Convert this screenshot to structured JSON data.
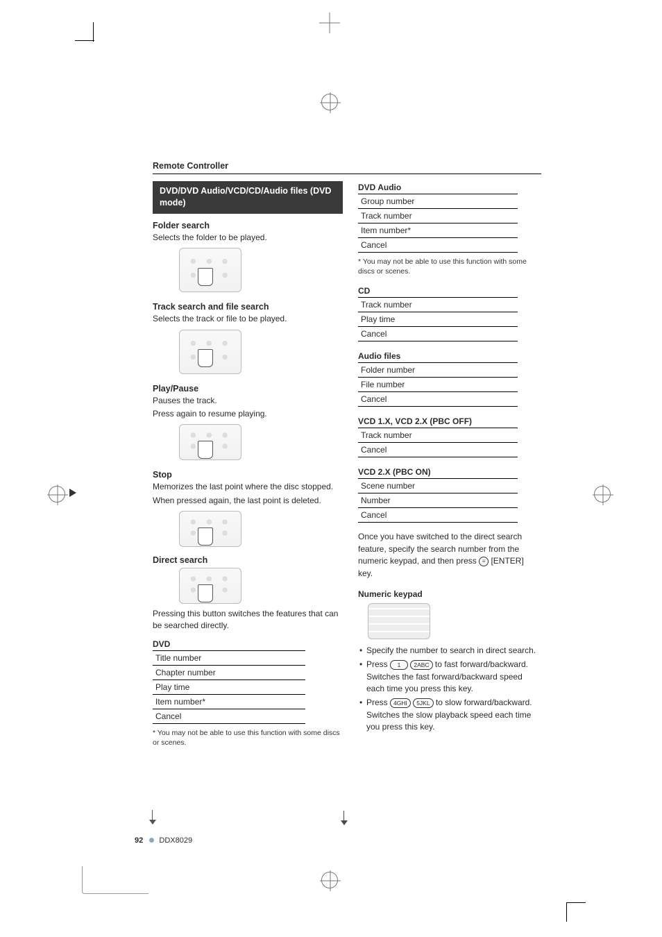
{
  "doc": {
    "header": "Remote Controller",
    "band": "DVD/DVD Audio/VCD/CD/Audio files (DVD mode)"
  },
  "left": {
    "folder_search": {
      "h": "Folder search",
      "p": "Selects the folder to be played."
    },
    "track_search": {
      "h": "Track search and file search",
      "p": "Selects the track or file to be played."
    },
    "play_pause": {
      "h": "Play/Pause",
      "p1": "Pauses the track.",
      "p2": "Press again to resume playing."
    },
    "stop": {
      "h": "Stop",
      "p1": "Memorizes the last point where the disc stopped.",
      "p2": "When pressed again, the last point is deleted."
    },
    "direct_search": {
      "h": "Direct search",
      "p": "Pressing this button switches the features that can be searched directly."
    },
    "dvd": {
      "h": "DVD",
      "rows": [
        "Title number",
        "Chapter number",
        "Play time",
        "Item number*",
        "Cancel"
      ],
      "note": "* You may not be able to use this function with some discs or scenes."
    }
  },
  "right": {
    "dvd_audio": {
      "h": "DVD Audio",
      "rows": [
        "Group number",
        "Track number",
        "Item number*",
        "Cancel"
      ],
      "note": "* You may not be able to use this function with some discs or scenes."
    },
    "cd": {
      "h": "CD",
      "rows": [
        "Track number",
        "Play time",
        "Cancel"
      ]
    },
    "audio_files": {
      "h": "Audio files",
      "rows": [
        "Folder number",
        "File number",
        "Cancel"
      ]
    },
    "vcd_pbc_off": {
      "h": "VCD 1.X, VCD 2.X (PBC OFF)",
      "rows": [
        "Track number",
        "Cancel"
      ]
    },
    "vcd_pbc_on": {
      "h": "VCD 2.X (PBC ON)",
      "rows": [
        "Scene number",
        "Number",
        "Cancel"
      ]
    },
    "after": "Once you have switched to the direct search feature, specify the search number from the numeric keypad, and then press ",
    "after_key": "[ENTER] key.",
    "num_keypad_h": "Numeric keypad",
    "bullets": [
      {
        "t": "Specify the number to search in direct search."
      },
      {
        "pre": "Press ",
        "k1": "1",
        "k2": "2ABC",
        "post": " to fast forward/backward. Switches the fast forward/backward speed each time you press this key."
      },
      {
        "pre": "Press ",
        "k1": "4GHI",
        "k2": "5JKL",
        "post": " to slow forward/backward. Switches the slow playback speed each time you press this key."
      }
    ]
  },
  "footer": {
    "page": "92",
    "model": "DDX8029"
  }
}
